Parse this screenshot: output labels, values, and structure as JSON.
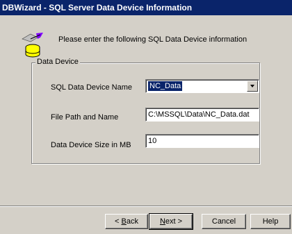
{
  "window": {
    "title": "DBWizard - SQL Server Data Device Information"
  },
  "intro_text": "Please enter the following SQL Data Device information",
  "icon": "database-icon",
  "group": {
    "label": "Data Device",
    "device_name": {
      "label": "SQL Data Device Name",
      "value": "NC_Data"
    },
    "file_path": {
      "label": "File Path and Name",
      "value": "C:\\MSSQL\\Data\\NC_Data.dat"
    },
    "device_size": {
      "label": "Data Device Size in MB",
      "value": "10"
    }
  },
  "buttons": {
    "back": {
      "mnemonic": "B",
      "rest": "ack",
      "prefix": "< "
    },
    "next": {
      "mnemonic": "N",
      "rest": "ext >"
    },
    "cancel": "Cancel",
    "help": "Help"
  },
  "colors": {
    "titlebar": "#0a246a",
    "face": "#d4d0c8",
    "highlight": "#0a246a"
  }
}
